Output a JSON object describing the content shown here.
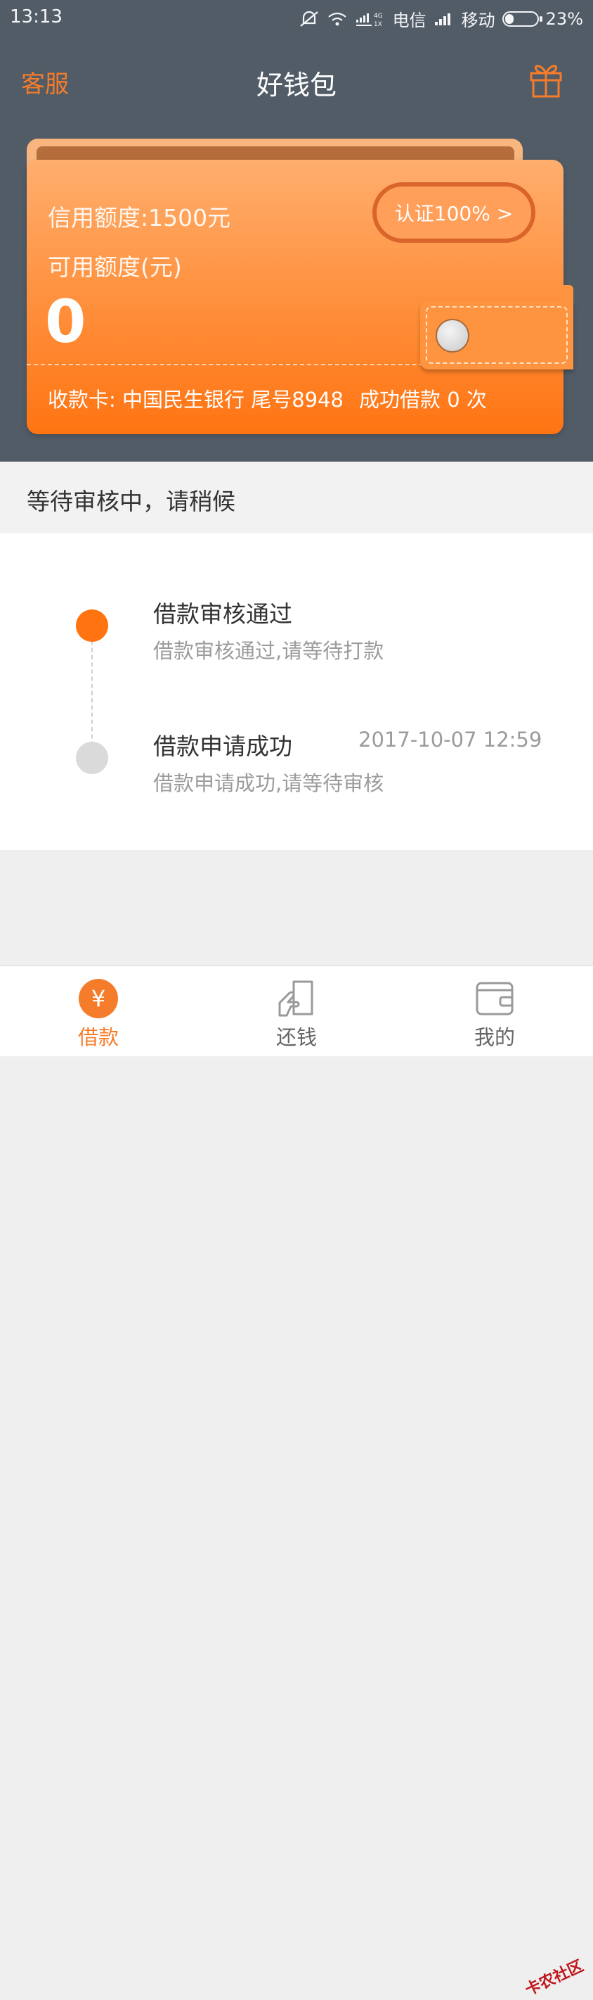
{
  "status_bar": {
    "time": "13:13",
    "network_small": "4G\n1X",
    "carrier1": "电信",
    "carrier2": "移动",
    "battery": "23%"
  },
  "header": {
    "left_link": "客服",
    "title": "好钱包",
    "right_icon": "gift-icon"
  },
  "card": {
    "credit_limit": "信用额度:1500元",
    "available_label": "可用额度(元)",
    "available_value": "0",
    "cert_button": "认证100% >",
    "receive_card": "收款卡: 中国民生银行 尾号8948",
    "success_count": "成功借款 0 次"
  },
  "status_banner": "等待审核中，请稍候",
  "timeline": [
    {
      "title": "借款审核通过",
      "subtitle": "借款审核通过,请等待打款",
      "time": "",
      "state": "active"
    },
    {
      "title": "借款申请成功",
      "subtitle": "借款申请成功,请等待审核",
      "time": "2017-10-07 12:59",
      "state": "inactive"
    }
  ],
  "bottom_nav": [
    {
      "label": "借款",
      "icon": "yen-icon",
      "active": true
    },
    {
      "label": "还钱",
      "icon": "repay-icon",
      "active": false
    },
    {
      "label": "我的",
      "icon": "wallet-icon",
      "active": false
    }
  ],
  "watermark": "卡农社区",
  "colors": {
    "accent": "#f57c2a",
    "header_bg": "#525c67",
    "card_top": "#ffae6e",
    "card_bottom": "#ff7412"
  }
}
